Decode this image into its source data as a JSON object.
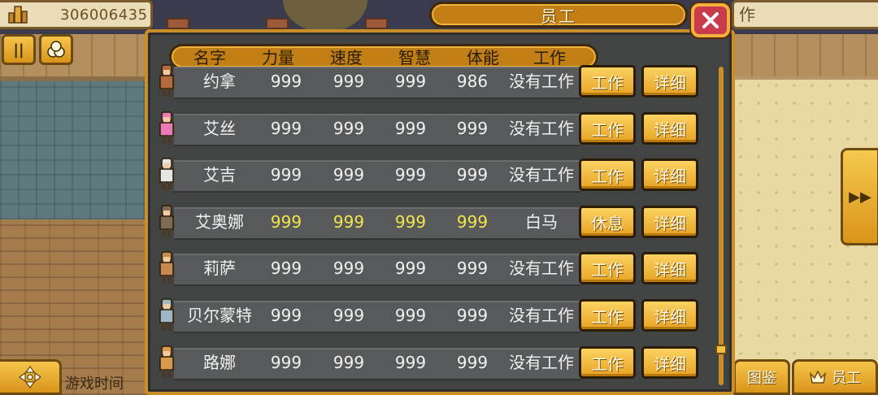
{
  "hud": {
    "money": "306006435",
    "right_label": "作",
    "game_time": "游戏时间",
    "bottom_buttons": [
      {
        "label": "图鉴",
        "icon": "book-icon"
      },
      {
        "label": "员工",
        "icon": "crown-icon"
      }
    ]
  },
  "dialog": {
    "title": "员工",
    "columns": [
      "名字",
      "力量",
      "速度",
      "智慧",
      "体能",
      "工作"
    ],
    "rows": [
      {
        "name": "约拿",
        "power": "999",
        "speed": "999",
        "wisdom": "999",
        "stamina": "986",
        "job": "没有工作",
        "highlight": false,
        "action": "工作",
        "detail": "详细",
        "avatar_color": "#b36a3c"
      },
      {
        "name": "艾丝",
        "power": "999",
        "speed": "999",
        "wisdom": "999",
        "stamina": "999",
        "job": "没有工作",
        "highlight": false,
        "action": "工作",
        "detail": "详细",
        "avatar_color": "#e87bb5"
      },
      {
        "name": "艾吉",
        "power": "999",
        "speed": "999",
        "wisdom": "999",
        "stamina": "999",
        "job": "没有工作",
        "highlight": false,
        "action": "工作",
        "detail": "详细",
        "avatar_color": "#e6e6e6"
      },
      {
        "name": "艾奥娜",
        "power": "999",
        "speed": "999",
        "wisdom": "999",
        "stamina": "999",
        "job": "白马",
        "highlight": true,
        "action": "休息",
        "detail": "详细",
        "avatar_color": "#7e6a55"
      },
      {
        "name": "莉萨",
        "power": "999",
        "speed": "999",
        "wisdom": "999",
        "stamina": "999",
        "job": "没有工作",
        "highlight": false,
        "action": "工作",
        "detail": "详细",
        "avatar_color": "#c48a52"
      },
      {
        "name": "贝尔蒙特",
        "power": "999",
        "speed": "999",
        "wisdom": "999",
        "stamina": "999",
        "job": "没有工作",
        "highlight": false,
        "action": "工作",
        "detail": "详细",
        "avatar_color": "#9fb8c8"
      },
      {
        "name": "路娜",
        "power": "999",
        "speed": "999",
        "wisdom": "999",
        "stamina": "999",
        "job": "没有工作",
        "highlight": false,
        "action": "工作",
        "detail": "详细",
        "avatar_color": "#d79a4e"
      }
    ]
  },
  "colors": {
    "accent_gold": "#f0b13e",
    "panel_gray": "#424343",
    "highlight_yellow": "#f2e44a",
    "close_red": "#c93a4a"
  }
}
